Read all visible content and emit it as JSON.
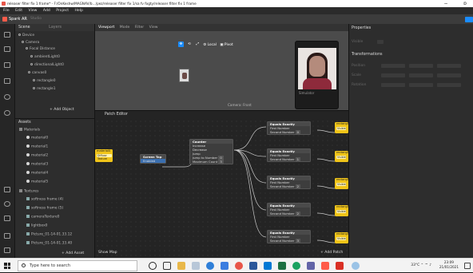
{
  "titlebar": {
    "title": "releaser filter fix 1 frame* - F:/OnKeshw/MAGNAV/b…/pez/releaser filter fix 1/sa fv fogty/releaser filter fix 1 frame",
    "min": "−",
    "close": "ɒ"
  },
  "menu": [
    "File",
    "Edit",
    "View",
    "Add",
    "Project",
    "Help"
  ],
  "app": {
    "name": "Spark AR",
    "edition": "Studio"
  },
  "scene_panel": {
    "tabs": [
      "Scene",
      "Layers"
    ],
    "tree": [
      "Device",
      "Camera",
      "Focal Distance",
      "ambientLight0",
      "directionalLight0",
      "canvas0",
      "rectangle0",
      "rectangle1"
    ],
    "add": "+ Add Object"
  },
  "assets_panel": {
    "title": "Assets",
    "folders": [
      "Materials",
      "Textures"
    ],
    "materials": [
      "material0",
      "material1",
      "material2",
      "material3",
      "material4",
      "material5"
    ],
    "textures": [
      "cameraTexture0",
      "Picture_01-14-01.33.12",
      "Picture_01-14-01.33.40",
      "lightbox0",
      "softness frame (4)",
      "softness frame (5)"
    ],
    "add": "+ Add Asset"
  },
  "viewport": {
    "tabs": [
      "Viewport",
      "Mode",
      "Filter",
      "View"
    ],
    "local": "Local",
    "pivot": "Pivot",
    "camera_label": "Camera: Front",
    "preview": "Simulator"
  },
  "patch_editor": {
    "title": "Patch Editor",
    "show_map": "Show Map",
    "add_patch": "+ Add Patch",
    "texture_node": {
      "title": "material0",
      "port": "Diffuse Texture"
    },
    "screen_tap": {
      "title": "Screen Tap",
      "port": "Enabled"
    },
    "counter": {
      "title": "Counter",
      "rows": [
        "Increase",
        "Decrease",
        "Jump",
        "Jump to Number",
        "Maximum Count"
      ],
      "jump_value": "0",
      "max_value": "3"
    },
    "equals": [
      {
        "title": "Equals Exactly",
        "first": "First Number",
        "second": "Second Number",
        "value": "0"
      },
      {
        "title": "Equals Exactly",
        "first": "First Number",
        "second": "Second Number",
        "value": "1"
      },
      {
        "title": "Equals Exactly",
        "first": "First Number",
        "second": "Second Number",
        "value": "2"
      },
      {
        "title": "Equals Exactly",
        "first": "First Number",
        "second": "Second Number",
        "value": "2"
      },
      {
        "title": "Equals Exactly",
        "first": "First Number",
        "second": "Second Number",
        "value": "3"
      }
    ],
    "outputs": [
      {
        "title": "rectangle0",
        "port": "Visible"
      },
      {
        "title": "rectangle1",
        "port": "Visible"
      },
      {
        "title": "rectangle2",
        "port": "Visible"
      },
      {
        "title": "rectangle3",
        "port": "Visible"
      },
      {
        "title": "rectangle4",
        "port": "Visible"
      }
    ]
  },
  "properties": {
    "title": "Properties",
    "visible": "Visible",
    "transformations": "Transformations",
    "rows": [
      "Position",
      "Scale",
      "Rotation"
    ]
  },
  "taskbar": {
    "search_placeholder": "Type here to search",
    "temp": "33°C",
    "time": "23:09",
    "date": "21/01/2021"
  },
  "colors": {
    "accent": "#1a8cff",
    "patch_yellow": "#f0c419",
    "brand": "#ff5c4a"
  }
}
